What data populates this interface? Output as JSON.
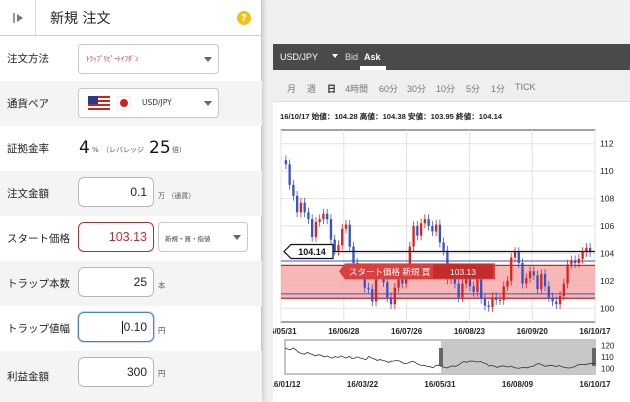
{
  "header": {
    "title": "新規 注文",
    "help": "?"
  },
  "form": {
    "order_type": {
      "label": "注文方法",
      "value": "ﾄﾗｯﾌﾟﾘﾋﾟｰﾄｲﾌﾀﾞﾝ"
    },
    "pair": {
      "label": "通貨ペア",
      "value": "USD/JPY"
    },
    "margin": {
      "label": "証拠金率",
      "pct": "4",
      "pct_unit": "%",
      "lev_label": "（レバレッジ",
      "lev": "25",
      "lev_unit": "倍）"
    },
    "amount": {
      "label": "注文金額",
      "value": "0.1",
      "unit": "万 （通貨）"
    },
    "start_price": {
      "label": "スタート価格",
      "value": "103.13",
      "side": "新規・買・指値"
    },
    "trap_count": {
      "label": "トラップ本数",
      "value": "25",
      "unit": "本"
    },
    "trap_width": {
      "label": "トラップ値幅",
      "value": "0.10",
      "unit": "円"
    },
    "profit": {
      "label": "利益金額",
      "value": "300",
      "unit": "円"
    }
  },
  "chart_panel": {
    "pair": "USD/JPY",
    "bid": "Bid",
    "ask": "Ask",
    "timeframes": [
      "月",
      "週",
      "日",
      "4時間",
      "60分",
      "30分",
      "10分",
      "5分",
      "1分",
      "TICK"
    ],
    "active_timeframe": "日",
    "ohlc_text": "16/10/17 始値：104.28 高値：104.38 安値：103.95 終値：104.14",
    "current_price_tag": "104.14",
    "start_label": "スタート価格 新規 買",
    "start_value": "103.13",
    "colors": {
      "up": "#e02020",
      "down": "#3355cc",
      "band": "#f5a5a5"
    }
  },
  "chart_data": {
    "type": "candlestick",
    "x_ticks": [
      "16/05/31",
      "16/06/28",
      "16/07/26",
      "16/08/23",
      "16/09/20",
      "16/10/17"
    ],
    "y_ticks": [
      100,
      102,
      104,
      106,
      108,
      110,
      112
    ],
    "ylim": [
      99,
      113
    ],
    "close_series": [
      110.5,
      109,
      108.2,
      107,
      107.7,
      107,
      106.5,
      105.2,
      106.3,
      106.5,
      106.9,
      106.5,
      105,
      104.2,
      104.6,
      105.8,
      106.1,
      104.5,
      103.3,
      102.5,
      102.6,
      101.5,
      101.4,
      100.5,
      102.5,
      102.8,
      101.9,
      100.8,
      100.3,
      101.5,
      102.1,
      101.8,
      102.8,
      104.5,
      106,
      105.3,
      106.2,
      106.5,
      106,
      105.6,
      106.1,
      104.8,
      104.2,
      102.1,
      102.5,
      101.8,
      100.8,
      101.8,
      102.2,
      101.6,
      101.2,
      102.1,
      100.7,
      100.2,
      100.1,
      100.8,
      100.6,
      100.6,
      101.6,
      102,
      103.7,
      104.1,
      103.3,
      101.8,
      102.2,
      102.7,
      102.4,
      101.4,
      102.5,
      101.6,
      100.8,
      100.5,
      100.3,
      100.9,
      101.8,
      103.2,
      103.5,
      103.3,
      103.6,
      104.1,
      104.4,
      104.1
    ],
    "mini_ticks": [
      "16/01/12",
      "16/03/22",
      "16/05/31",
      "16/08/09",
      "16/10/17"
    ],
    "mini_y_ticks": [
      100,
      110,
      120
    ]
  }
}
